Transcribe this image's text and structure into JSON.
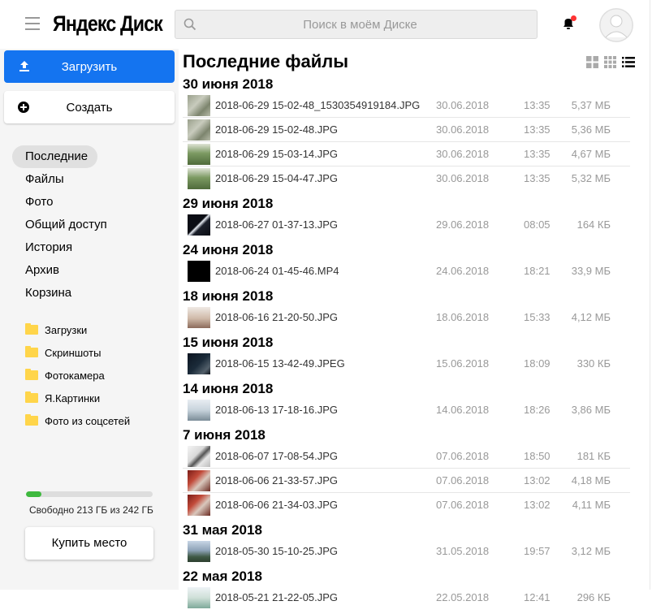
{
  "header": {
    "logo": "Яндекс Диск",
    "search_placeholder": "Поиск в моём Диске",
    "icons": [
      "menu-icon",
      "search-icon",
      "bell-icon",
      "avatar-icon"
    ]
  },
  "sidebar": {
    "upload_label": "Загрузить",
    "create_label": "Создать",
    "nav": [
      {
        "label": "Последние",
        "active": true
      },
      {
        "label": "Файлы"
      },
      {
        "label": "Фото"
      },
      {
        "label": "Общий доступ"
      },
      {
        "label": "История"
      },
      {
        "label": "Архив"
      },
      {
        "label": "Корзина"
      }
    ],
    "folders": [
      "Загрузки",
      "Скриншоты",
      "Фотокамера",
      "Я.Картинки",
      "Фото из соцсетей"
    ],
    "quota_text": "Свободно 213 ГБ из 242 ГБ",
    "quota_used_fraction": 0.12,
    "buy_label": "Купить место"
  },
  "main": {
    "title": "Последние файлы",
    "view_icons": [
      "large-tiles-icon",
      "small-tiles-icon",
      "list-view-icon"
    ],
    "groups": [
      {
        "title": "30 июня 2018",
        "files": [
          {
            "name": "2018-06-29 15-02-48_1530354919184.JPG",
            "date": "30.06.2018",
            "time": "13:35",
            "size": "5,37 МБ",
            "thumb": "grass"
          },
          {
            "name": "2018-06-29 15-02-48.JPG",
            "date": "30.06.2018",
            "time": "13:35",
            "size": "5,36 МБ",
            "thumb": "grass"
          },
          {
            "name": "2018-06-29 15-03-14.JPG",
            "date": "30.06.2018",
            "time": "13:35",
            "size": "4,67 МБ",
            "thumb": "field"
          },
          {
            "name": "2018-06-29 15-04-47.JPG",
            "date": "30.06.2018",
            "time": "13:35",
            "size": "5,32 МБ",
            "thumb": "field"
          }
        ]
      },
      {
        "title": "29 июня 2018",
        "files": [
          {
            "name": "2018-06-27 01-37-13.JPG",
            "date": "29.06.2018",
            "time": "08:05",
            "size": "164 КБ",
            "thumb": "dark-light"
          }
        ]
      },
      {
        "title": "24 июня 2018",
        "files": [
          {
            "name": "2018-06-24 01-45-46.MP4",
            "date": "24.06.2018",
            "time": "18:21",
            "size": "33,9 МБ",
            "thumb": "black"
          }
        ]
      },
      {
        "title": "18 июня 2018",
        "files": [
          {
            "name": "2018-06-16 21-20-50.JPG",
            "date": "18.06.2018",
            "time": "15:33",
            "size": "4,12 МБ",
            "thumb": "room"
          }
        ]
      },
      {
        "title": "15 июня 2018",
        "files": [
          {
            "name": "2018-06-15 13-42-49.JPEG",
            "date": "15.06.2018",
            "time": "18:09",
            "size": "330 КБ",
            "thumb": "night"
          }
        ]
      },
      {
        "title": "14 июня 2018",
        "files": [
          {
            "name": "2018-06-13 17-18-16.JPG",
            "date": "14.06.2018",
            "time": "18:26",
            "size": "3,86 МБ",
            "thumb": "interior"
          }
        ]
      },
      {
        "title": "7 июня 2018",
        "files": [
          {
            "name": "2018-06-07 17-08-54.JPG",
            "date": "07.06.2018",
            "time": "18:50",
            "size": "181 КБ",
            "thumb": "sketch"
          },
          {
            "name": "2018-06-06 21-33-57.JPG",
            "date": "07.06.2018",
            "time": "13:02",
            "size": "4,18 МБ",
            "thumb": "people"
          },
          {
            "name": "2018-06-06 21-34-03.JPG",
            "date": "07.06.2018",
            "time": "13:02",
            "size": "4,11 МБ",
            "thumb": "people"
          }
        ]
      },
      {
        "title": "31 мая 2018",
        "files": [
          {
            "name": "2018-05-30 15-10-25.JPG",
            "date": "31.05.2018",
            "time": "19:57",
            "size": "3,12 МБ",
            "thumb": "crowd"
          }
        ]
      },
      {
        "title": "22 мая 2018",
        "files": [
          {
            "name": "2018-05-21 21-22-05.JPG",
            "date": "22.05.2018",
            "time": "12:41",
            "size": "296 КБ",
            "thumb": "screen"
          }
        ]
      }
    ]
  }
}
